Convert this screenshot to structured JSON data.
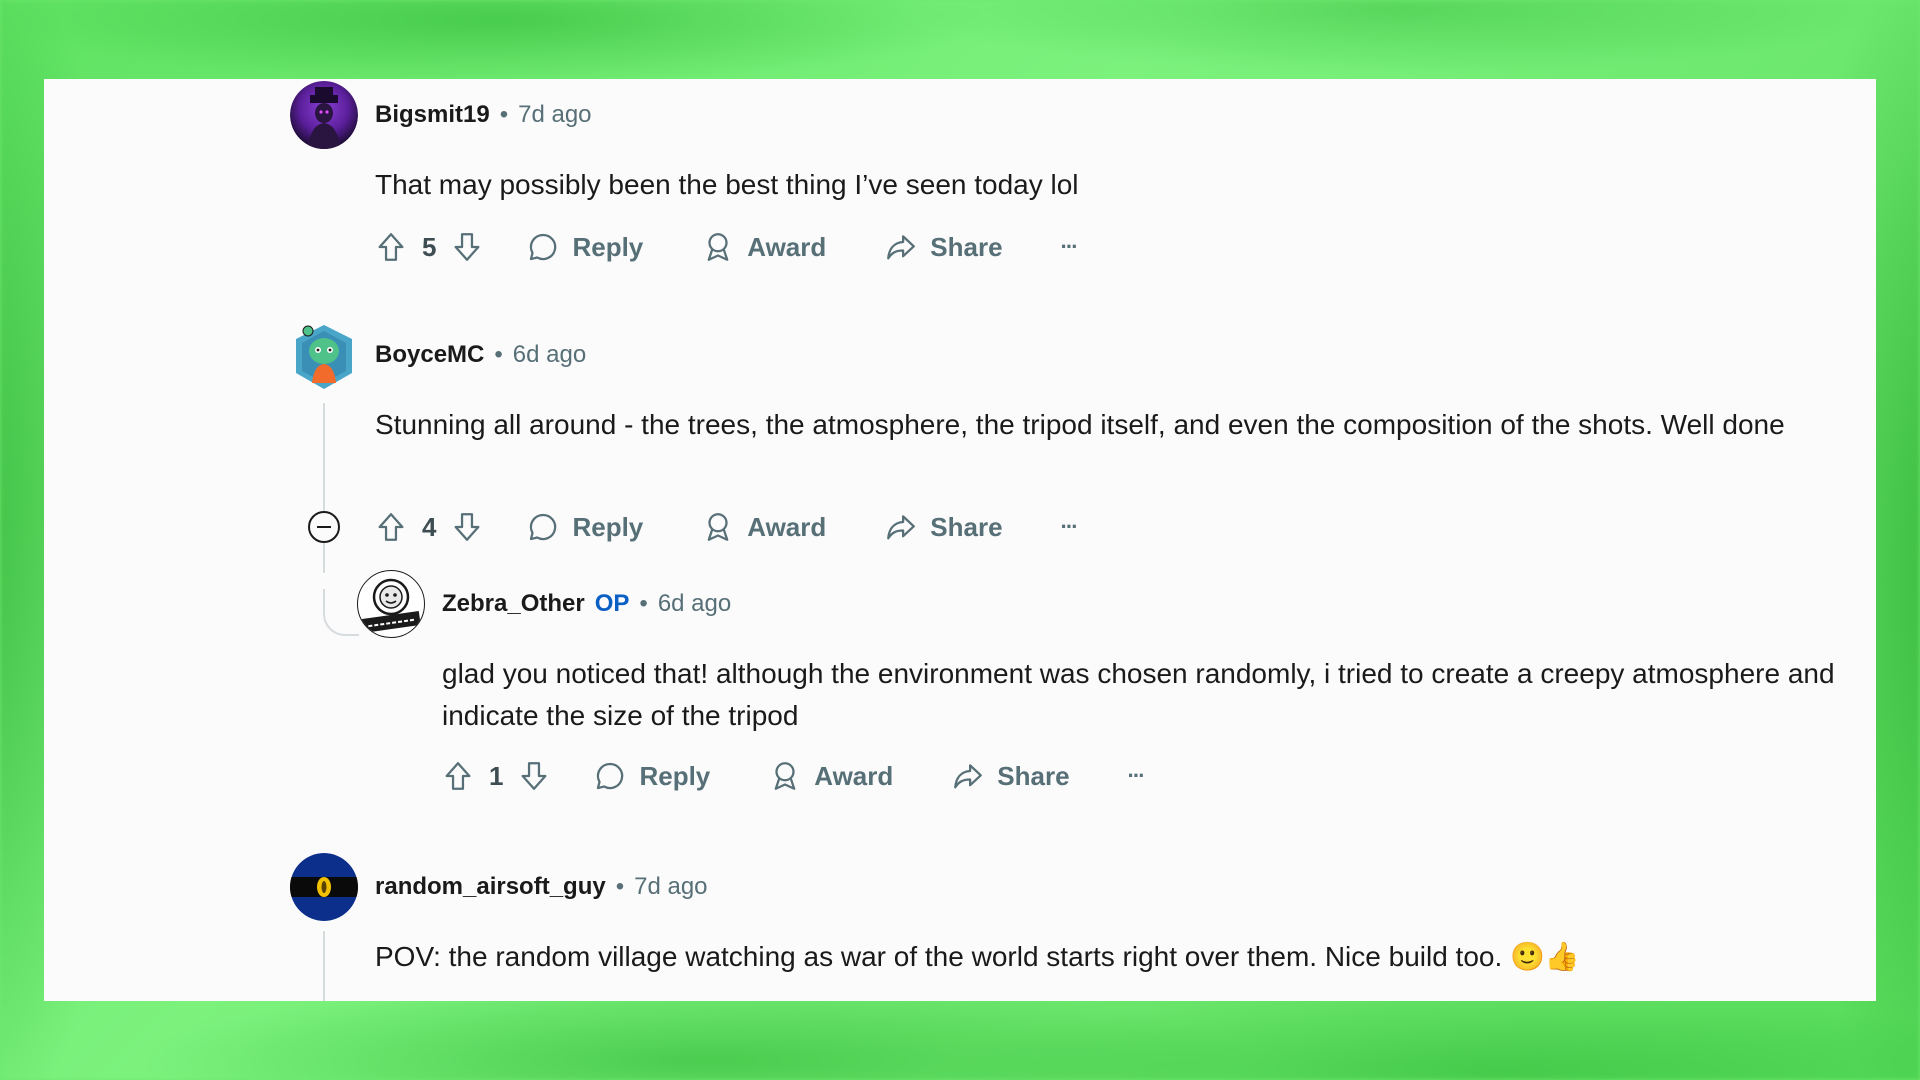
{
  "comments": [
    {
      "author": "Bigsmit19",
      "op_badge": "",
      "separator": "•",
      "age": "7d ago",
      "text": "That may possibly been the best thing I’ve seen today lol",
      "score": "5"
    },
    {
      "author": "BoyceMC",
      "op_badge": "",
      "separator": "•",
      "age": "6d ago",
      "text": "Stunning all around - the trees, the atmosphere, the tripod itself, and even the composition of the shots. Well done",
      "score": "4"
    },
    {
      "author": "Zebra_Other",
      "op_badge": "OP",
      "separator": "•",
      "age": "6d ago",
      "text": "glad you noticed that! although the environment was chosen randomly, i tried to create a creepy atmosphere and indicate the size of the tripod",
      "score": "1"
    },
    {
      "author": "random_airsoft_guy",
      "op_badge": "",
      "separator": "•",
      "age": "7d ago",
      "text": "POV: the random village watching as war of the world starts right over them. Nice build too. 🙂👍",
      "score": ""
    }
  ],
  "actions": {
    "reply_label": "Reply",
    "award_label": "Award",
    "share_label": "Share",
    "more_label": "···"
  },
  "icons": {
    "upvote": "arrow-up-outline-icon",
    "downvote": "arrow-down-outline-icon",
    "reply": "speech-bubble-icon",
    "award": "ribbon-award-icon",
    "share": "share-arrow-icon",
    "more": "ellipsis-icon",
    "collapse": "minus-circle-icon"
  },
  "colors": {
    "background_green": "#6ee86f",
    "panel": "#fbfbfc",
    "text": "#1a1a1b",
    "muted": "#576f76",
    "op_blue": "#0a5fc4"
  }
}
